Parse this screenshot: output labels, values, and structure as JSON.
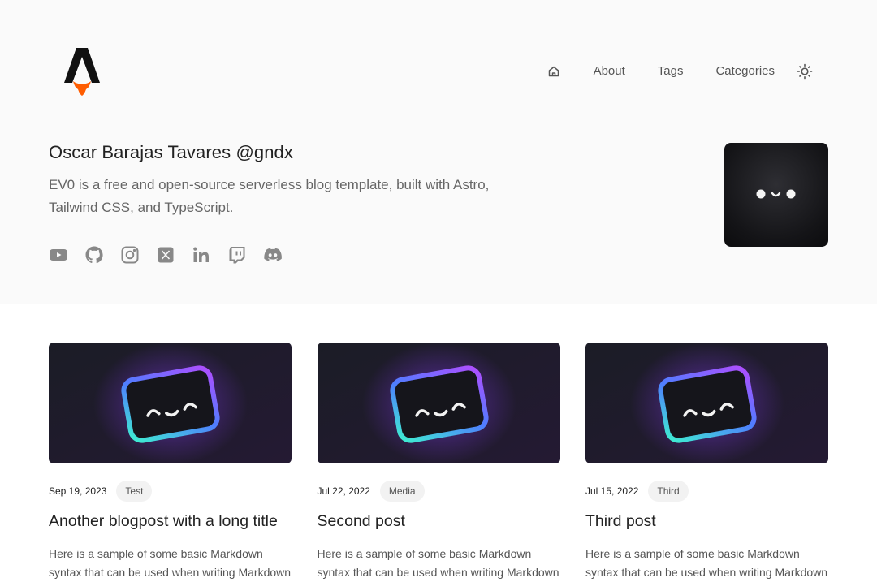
{
  "nav": {
    "home_icon": "home-icon",
    "items": [
      {
        "label": "About"
      },
      {
        "label": "Tags"
      },
      {
        "label": "Categories"
      }
    ],
    "theme_icon": "sun-icon"
  },
  "author": {
    "name": "Oscar Barajas Tavares @gndx",
    "bio": "EV0 is a free and open-source serverless blog template, built with Astro, Tailwind CSS, and TypeScript."
  },
  "socials": [
    {
      "icon": "youtube-icon"
    },
    {
      "icon": "github-icon"
    },
    {
      "icon": "instagram-icon"
    },
    {
      "icon": "x-icon"
    },
    {
      "icon": "linkedin-icon"
    },
    {
      "icon": "twitch-icon"
    },
    {
      "icon": "discord-icon"
    }
  ],
  "posts": [
    {
      "date": "Sep 19, 2023",
      "tag": "Test",
      "title": "Another blogpost with a long title",
      "excerpt": "Here is a sample of some basic Markdown syntax that can be used when writing Markdown"
    },
    {
      "date": "Jul 22, 2022",
      "tag": "Media",
      "title": "Second post",
      "excerpt": "Here is a sample of some basic Markdown syntax that can be used when writing Markdown"
    },
    {
      "date": "Jul 15, 2022",
      "tag": "Third",
      "title": "Third post",
      "excerpt": "Here is a sample of some basic Markdown syntax that can be used when writing Markdown"
    }
  ],
  "colors": {
    "hero_bg": "#fafafa",
    "logo_black": "#111111",
    "logo_orange": "#ff5d01",
    "icon_gray": "#888888"
  }
}
